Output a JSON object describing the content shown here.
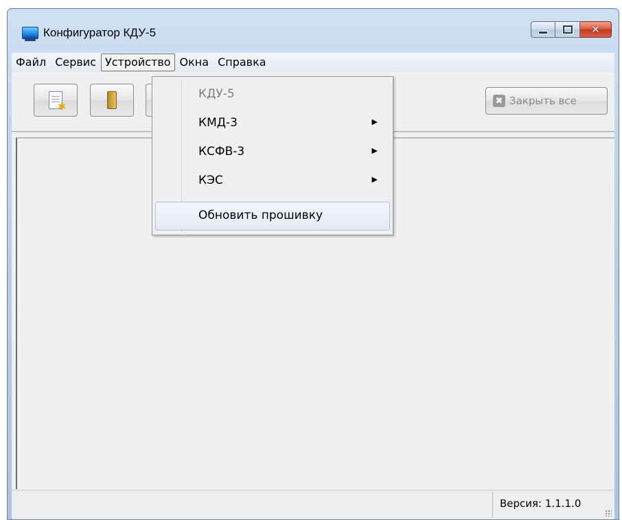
{
  "window": {
    "title": "Конфигуратор КДУ-5"
  },
  "menubar": {
    "items": [
      "Файл",
      "Сервис",
      "Устройство",
      "Окна",
      "Справка"
    ],
    "active": "Устройство"
  },
  "toolbar": {
    "close_all_label": "Закрыть все",
    "icons": [
      "new-document-icon",
      "open-folder-icon",
      "partial-button-icon"
    ]
  },
  "device_menu": {
    "items": [
      {
        "label": "КДУ-5",
        "disabled": true,
        "submenu": false
      },
      {
        "label": "КМД-3",
        "disabled": false,
        "submenu": true
      },
      {
        "label": "КСФВ-3",
        "disabled": false,
        "submenu": true
      },
      {
        "label": "КЭС",
        "disabled": false,
        "submenu": true
      },
      {
        "label": "Обновить прошивку",
        "disabled": false,
        "submenu": false,
        "highlighted": true
      }
    ]
  },
  "statusbar": {
    "version": "Версия: 1.1.1.0"
  }
}
